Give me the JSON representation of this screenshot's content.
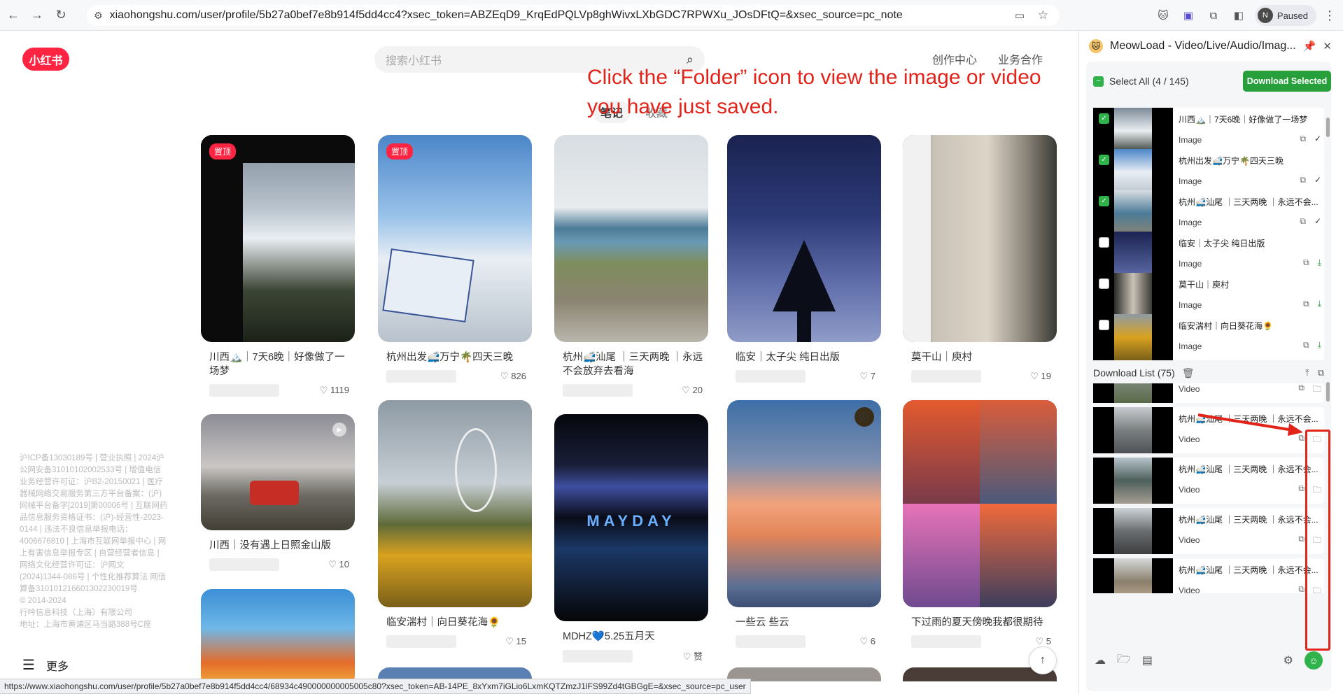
{
  "browser": {
    "url": "xiaohongshu.com/user/profile/5b27a0bef7e8b914f5dd4cc4?xsec_token=ABZEqD9_KrqEdPQLVp8ghWivxLXbGDC7RPWXu_JOsDFtQ=&xsec_source=pc_note",
    "profile_initial": "N",
    "profile_status": "Paused",
    "status_url": "https://www.xiaohongshu.com/user/profile/5b27a0bef7e8b914f5dd4cc4/68934c490000000005005c80?xsec_token=AB-14PE_8xYxm7iGLio6LxmKQTZmzJ1lFS99Zd4tGBGgE=&xsec_source=pc_user"
  },
  "site": {
    "logo": "小红书",
    "search_placeholder": "搜索小红书",
    "nav": [
      "创作中心",
      "业务合作"
    ],
    "tabs": {
      "notes": "笔记",
      "favorites": "收藏"
    },
    "more": "更多",
    "footer": "沪ICP备13030189号 | 营业执照 | 2024沪公网安备31010102002533号 | 增值电信业务经营许可证：沪B2-20150021 | 医疗器械网络交易服务第三方平台备案：(沪)网械平台备字[2019]第00006号 | 互联网药品信息服务资格证书：(沪)-经营性-2023-0144 | 违法不良信息举报电话：4006676810 | 上海市互联网举报中心 | 网上有害信息举报专区 | 自营经营者信息 | 网络文化经营许可证：沪网文(2024)1344-086号 | 个性化推荐算法 网信算备310101216601302230019号\n© 2014-2024\n行吟信息科技（上海）有限公司\n地址：上海市黄浦区马当路388号C座"
  },
  "annotation": {
    "hint": "Click the “Folder” icon to view the image or video you have just saved."
  },
  "cards": [
    {
      "pin": "置顶",
      "title": "川西🏔️｜7天6晚｜好像做了一场梦",
      "likes": "1119"
    },
    {
      "pin": "置顶",
      "title": "杭州出发🚅万宁🌴四天三晚",
      "likes": "826"
    },
    {
      "title": "杭州🚅汕尾 ｜三天两晚 ｜永远不会放弃去看海",
      "likes": "20"
    },
    {
      "title": "临安｜太子尖 纯日出版",
      "likes": "7"
    },
    {
      "title": "莫干山｜庾村",
      "likes": "19"
    },
    {
      "title": "川西｜没有遇上日照金山版",
      "likes": "10"
    },
    {
      "title": "临安湍村｜向日葵花海🌻",
      "likes": "15"
    },
    {
      "title": "MDHZ💙5.25五月天",
      "likes": "赞"
    },
    {
      "title": "一些云 些云",
      "likes": "6"
    },
    {
      "title": "下过雨的夏天傍晚我都很期待",
      "likes": "5"
    }
  ],
  "panel": {
    "title": "MeowLoad - Video/Live/Audio/Imag...",
    "select_all": "Select All (4 / 145)",
    "download_selected": "Download Selected",
    "items": [
      {
        "name": "川西🏔️｜7天6晚｜好像做了一场梦",
        "type": "Image",
        "checked": true
      },
      {
        "name": "杭州出发🚅万宁🌴四天三晚",
        "type": "Image",
        "checked": true
      },
      {
        "name": "杭州🚅汕尾 ｜三天两晚 ｜永远不会...",
        "type": "Image",
        "checked": true
      },
      {
        "name": "临安｜太子尖 纯日出版",
        "type": "Image",
        "checked": false
      },
      {
        "name": "莫干山｜庾村",
        "type": "Image",
        "checked": false
      },
      {
        "name": "临安湍村｜向日葵花海🌻",
        "type": "Image",
        "checked": false
      }
    ],
    "download_list_label": "Download List (75)",
    "downloads": [
      {
        "name": "",
        "type": "Video"
      },
      {
        "name": "杭州🚅汕尾 ｜三天两晚 ｜永远不会...",
        "type": "Video"
      },
      {
        "name": "杭州🚅汕尾 ｜三天两晚 ｜永远不会...",
        "type": "Video"
      },
      {
        "name": "杭州🚅汕尾 ｜三天两晚 ｜永远不会...",
        "type": "Video"
      },
      {
        "name": "杭州🚅汕尾 ｜三天两晚 ｜永远不会...",
        "type": "Video"
      }
    ]
  }
}
